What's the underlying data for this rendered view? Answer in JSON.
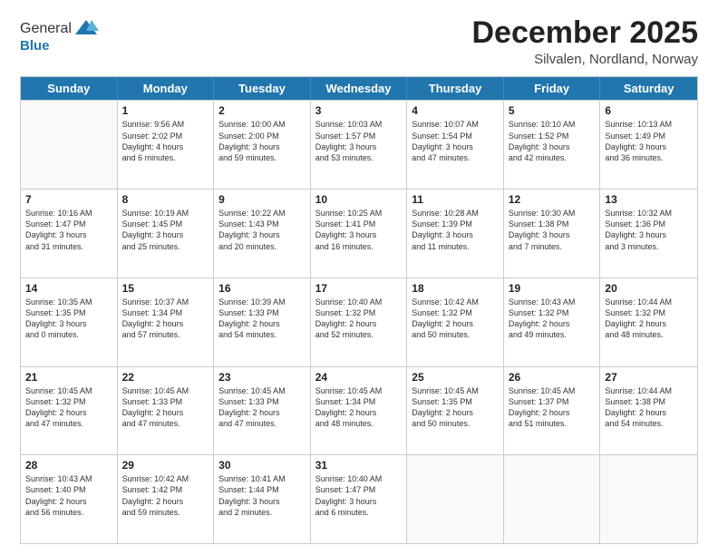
{
  "header": {
    "logo_general": "General",
    "logo_blue": "Blue",
    "month_title": "December 2025",
    "location": "Silvalen, Nordland, Norway"
  },
  "days_of_week": [
    "Sunday",
    "Monday",
    "Tuesday",
    "Wednesday",
    "Thursday",
    "Friday",
    "Saturday"
  ],
  "weeks": [
    [
      {
        "day": "",
        "empty": true,
        "lines": []
      },
      {
        "day": "1",
        "empty": false,
        "lines": [
          "Sunrise: 9:56 AM",
          "Sunset: 2:02 PM",
          "Daylight: 4 hours",
          "and 6 minutes."
        ]
      },
      {
        "day": "2",
        "empty": false,
        "lines": [
          "Sunrise: 10:00 AM",
          "Sunset: 2:00 PM",
          "Daylight: 3 hours",
          "and 59 minutes."
        ]
      },
      {
        "day": "3",
        "empty": false,
        "lines": [
          "Sunrise: 10:03 AM",
          "Sunset: 1:57 PM",
          "Daylight: 3 hours",
          "and 53 minutes."
        ]
      },
      {
        "day": "4",
        "empty": false,
        "lines": [
          "Sunrise: 10:07 AM",
          "Sunset: 1:54 PM",
          "Daylight: 3 hours",
          "and 47 minutes."
        ]
      },
      {
        "day": "5",
        "empty": false,
        "lines": [
          "Sunrise: 10:10 AM",
          "Sunset: 1:52 PM",
          "Daylight: 3 hours",
          "and 42 minutes."
        ]
      },
      {
        "day": "6",
        "empty": false,
        "lines": [
          "Sunrise: 10:13 AM",
          "Sunset: 1:49 PM",
          "Daylight: 3 hours",
          "and 36 minutes."
        ]
      }
    ],
    [
      {
        "day": "7",
        "empty": false,
        "lines": [
          "Sunrise: 10:16 AM",
          "Sunset: 1:47 PM",
          "Daylight: 3 hours",
          "and 31 minutes."
        ]
      },
      {
        "day": "8",
        "empty": false,
        "lines": [
          "Sunrise: 10:19 AM",
          "Sunset: 1:45 PM",
          "Daylight: 3 hours",
          "and 25 minutes."
        ]
      },
      {
        "day": "9",
        "empty": false,
        "lines": [
          "Sunrise: 10:22 AM",
          "Sunset: 1:43 PM",
          "Daylight: 3 hours",
          "and 20 minutes."
        ]
      },
      {
        "day": "10",
        "empty": false,
        "lines": [
          "Sunrise: 10:25 AM",
          "Sunset: 1:41 PM",
          "Daylight: 3 hours",
          "and 16 minutes."
        ]
      },
      {
        "day": "11",
        "empty": false,
        "lines": [
          "Sunrise: 10:28 AM",
          "Sunset: 1:39 PM",
          "Daylight: 3 hours",
          "and 11 minutes."
        ]
      },
      {
        "day": "12",
        "empty": false,
        "lines": [
          "Sunrise: 10:30 AM",
          "Sunset: 1:38 PM",
          "Daylight: 3 hours",
          "and 7 minutes."
        ]
      },
      {
        "day": "13",
        "empty": false,
        "lines": [
          "Sunrise: 10:32 AM",
          "Sunset: 1:36 PM",
          "Daylight: 3 hours",
          "and 3 minutes."
        ]
      }
    ],
    [
      {
        "day": "14",
        "empty": false,
        "lines": [
          "Sunrise: 10:35 AM",
          "Sunset: 1:35 PM",
          "Daylight: 3 hours",
          "and 0 minutes."
        ]
      },
      {
        "day": "15",
        "empty": false,
        "lines": [
          "Sunrise: 10:37 AM",
          "Sunset: 1:34 PM",
          "Daylight: 2 hours",
          "and 57 minutes."
        ]
      },
      {
        "day": "16",
        "empty": false,
        "lines": [
          "Sunrise: 10:39 AM",
          "Sunset: 1:33 PM",
          "Daylight: 2 hours",
          "and 54 minutes."
        ]
      },
      {
        "day": "17",
        "empty": false,
        "lines": [
          "Sunrise: 10:40 AM",
          "Sunset: 1:32 PM",
          "Daylight: 2 hours",
          "and 52 minutes."
        ]
      },
      {
        "day": "18",
        "empty": false,
        "lines": [
          "Sunrise: 10:42 AM",
          "Sunset: 1:32 PM",
          "Daylight: 2 hours",
          "and 50 minutes."
        ]
      },
      {
        "day": "19",
        "empty": false,
        "lines": [
          "Sunrise: 10:43 AM",
          "Sunset: 1:32 PM",
          "Daylight: 2 hours",
          "and 49 minutes."
        ]
      },
      {
        "day": "20",
        "empty": false,
        "lines": [
          "Sunrise: 10:44 AM",
          "Sunset: 1:32 PM",
          "Daylight: 2 hours",
          "and 48 minutes."
        ]
      }
    ],
    [
      {
        "day": "21",
        "empty": false,
        "lines": [
          "Sunrise: 10:45 AM",
          "Sunset: 1:32 PM",
          "Daylight: 2 hours",
          "and 47 minutes."
        ]
      },
      {
        "day": "22",
        "empty": false,
        "lines": [
          "Sunrise: 10:45 AM",
          "Sunset: 1:33 PM",
          "Daylight: 2 hours",
          "and 47 minutes."
        ]
      },
      {
        "day": "23",
        "empty": false,
        "lines": [
          "Sunrise: 10:45 AM",
          "Sunset: 1:33 PM",
          "Daylight: 2 hours",
          "and 47 minutes."
        ]
      },
      {
        "day": "24",
        "empty": false,
        "lines": [
          "Sunrise: 10:45 AM",
          "Sunset: 1:34 PM",
          "Daylight: 2 hours",
          "and 48 minutes."
        ]
      },
      {
        "day": "25",
        "empty": false,
        "lines": [
          "Sunrise: 10:45 AM",
          "Sunset: 1:35 PM",
          "Daylight: 2 hours",
          "and 50 minutes."
        ]
      },
      {
        "day": "26",
        "empty": false,
        "lines": [
          "Sunrise: 10:45 AM",
          "Sunset: 1:37 PM",
          "Daylight: 2 hours",
          "and 51 minutes."
        ]
      },
      {
        "day": "27",
        "empty": false,
        "lines": [
          "Sunrise: 10:44 AM",
          "Sunset: 1:38 PM",
          "Daylight: 2 hours",
          "and 54 minutes."
        ]
      }
    ],
    [
      {
        "day": "28",
        "empty": false,
        "lines": [
          "Sunrise: 10:43 AM",
          "Sunset: 1:40 PM",
          "Daylight: 2 hours",
          "and 56 minutes."
        ]
      },
      {
        "day": "29",
        "empty": false,
        "lines": [
          "Sunrise: 10:42 AM",
          "Sunset: 1:42 PM",
          "Daylight: 2 hours",
          "and 59 minutes."
        ]
      },
      {
        "day": "30",
        "empty": false,
        "lines": [
          "Sunrise: 10:41 AM",
          "Sunset: 1:44 PM",
          "Daylight: 3 hours",
          "and 2 minutes."
        ]
      },
      {
        "day": "31",
        "empty": false,
        "lines": [
          "Sunrise: 10:40 AM",
          "Sunset: 1:47 PM",
          "Daylight: 3 hours",
          "and 6 minutes."
        ]
      },
      {
        "day": "",
        "empty": true,
        "lines": []
      },
      {
        "day": "",
        "empty": true,
        "lines": []
      },
      {
        "day": "",
        "empty": true,
        "lines": []
      }
    ]
  ]
}
